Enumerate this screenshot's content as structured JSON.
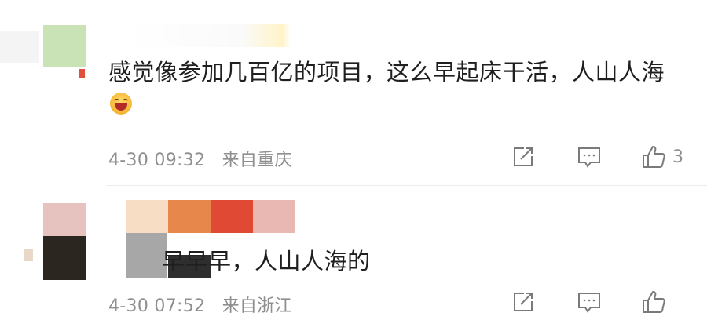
{
  "comments": [
    {
      "text": "感觉像参加几百亿的项目，这么早起床干活，人山人海",
      "emoji_icon": "laughing-face-icon",
      "time": "4-30 09:32",
      "location": "来自重庆",
      "like_count": "3"
    },
    {
      "text": "早早早，人山人海的",
      "time": "4-30 07:52",
      "location": "来自浙江",
      "like_count": ""
    }
  ],
  "icons": {
    "share": "share-icon",
    "comment": "comment-icon",
    "like": "thumbs-up-icon"
  },
  "colors": {
    "text": "#1f1f1f",
    "meta": "#8f8f8f",
    "icon": "#7a7a7a",
    "divider": "#ececec"
  }
}
